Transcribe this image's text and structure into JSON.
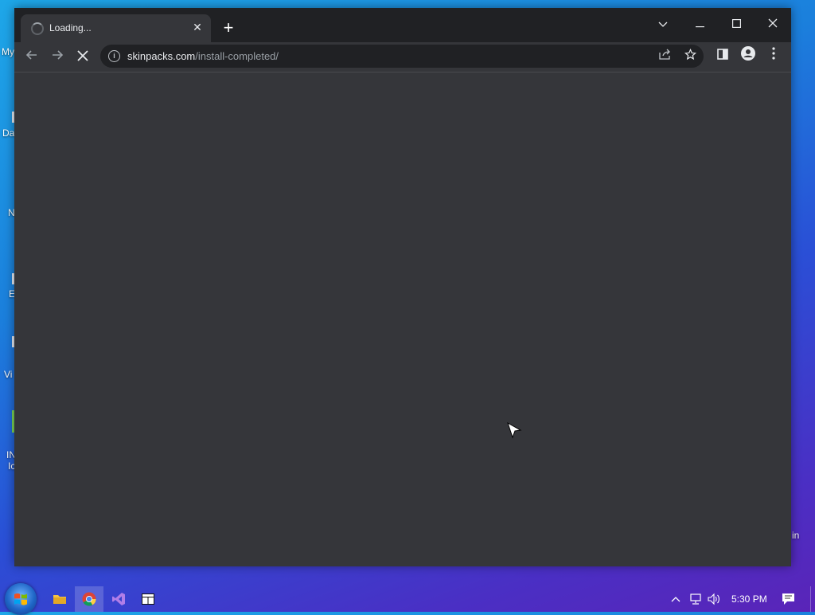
{
  "desktop": {
    "fragments": [
      "My",
      "Da",
      "N",
      "E",
      "Vi",
      "IN",
      "Ic",
      "in"
    ]
  },
  "browser": {
    "tab": {
      "title": "Loading...",
      "close_label": "✕"
    },
    "new_tab_label": "+",
    "window_controls": {
      "tabsearch": "⌄",
      "minimize": "—",
      "maximize": "☐",
      "close": "✕"
    },
    "nav": {
      "back": "←",
      "forward": "→",
      "stop": "✕"
    },
    "omnibox": {
      "host": "skinpacks.com",
      "path": "/install-completed/"
    }
  },
  "taskbar": {
    "clock": "5:30 PM"
  },
  "colors": {
    "titlebar": "#202124",
    "toolbar": "#35363a",
    "omnibox": "#202124"
  }
}
